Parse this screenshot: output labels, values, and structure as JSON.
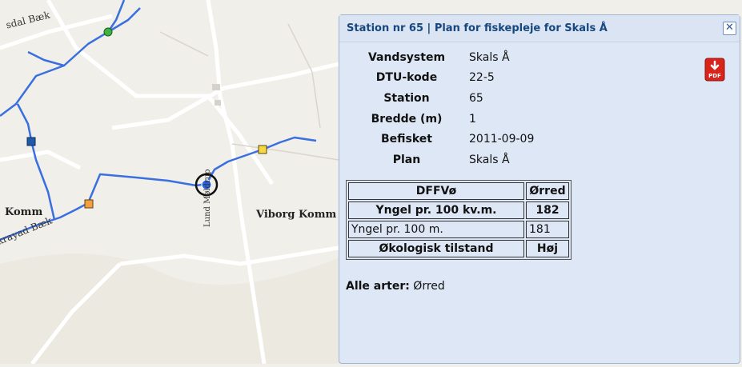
{
  "map": {
    "labels": {
      "sdal_baek": "sdal Bæk",
      "komm": "Komm",
      "kravad_baek": "krayad Bæk",
      "viborg_komm": "Viborg Komm",
      "lund_moldrup": "Lund     Møldrup"
    },
    "colors": {
      "river": "#3a6fe0",
      "road": "#ffffff",
      "background": "#f1efe9"
    },
    "markers": [
      {
        "kind": "green-station",
        "color": "#3fb33f"
      },
      {
        "kind": "blue-station",
        "color": "#1f5aa8"
      },
      {
        "kind": "orange-station",
        "color": "#f0a040"
      },
      {
        "kind": "yellow-station",
        "color": "#f5d742"
      },
      {
        "kind": "selected-station",
        "color": "#2b62e3"
      }
    ]
  },
  "popup": {
    "title": "Station nr 65 | Plan for fiskepleje for Skals Å",
    "close_label": "✕",
    "pdf_icon": "pdf-download-icon",
    "info": [
      {
        "key": "Vandsystem",
        "value": "Skals Å"
      },
      {
        "key": "DTU-kode",
        "value": "22-5"
      },
      {
        "key": "Station",
        "value": "65"
      },
      {
        "key": "Bredde (m)",
        "value": "1"
      },
      {
        "key": "Befisket",
        "value": "2011-09-09"
      },
      {
        "key": "Plan",
        "value": "Skals Å"
      }
    ],
    "table": {
      "header": {
        "label": "DFFVø",
        "value": "Ørred"
      },
      "rows": [
        {
          "label": "Yngel pr. 100 kv.m.",
          "value": "182"
        },
        {
          "label": "Yngel pr. 100 m.",
          "value": "181"
        },
        {
          "label": "Økologisk tilstand",
          "value": "Høj"
        }
      ]
    },
    "alle_label": "Alle arter:",
    "alle_value": "Ørred"
  }
}
